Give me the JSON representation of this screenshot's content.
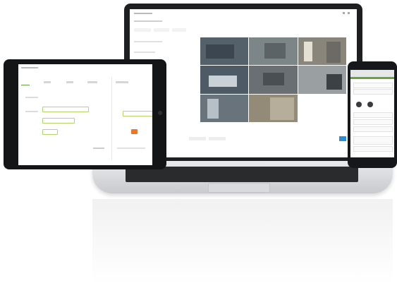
{
  "laptop_screen": {
    "cameras": [
      {
        "name": "camera-feed-1",
        "tone": "#55616a"
      },
      {
        "name": "camera-feed-2",
        "tone": "#7c8588"
      },
      {
        "name": "camera-feed-3",
        "tone": "#8a857b"
      },
      {
        "name": "camera-feed-4",
        "tone": "#4e5a66"
      },
      {
        "name": "camera-feed-5",
        "tone": "#6a6f74"
      },
      {
        "name": "camera-feed-6",
        "tone": "#9aa0a2"
      },
      {
        "name": "camera-feed-7",
        "tone": "#69737c"
      },
      {
        "name": "camera-feed-8",
        "tone": "#948a78"
      },
      {
        "name": "camera-feed-9",
        "tone": "#ffffff"
      }
    ]
  },
  "colors": {
    "accent_green": "#63a53b",
    "accent_blue": "#2a8fd6",
    "accent_orange": "#e8772e"
  }
}
